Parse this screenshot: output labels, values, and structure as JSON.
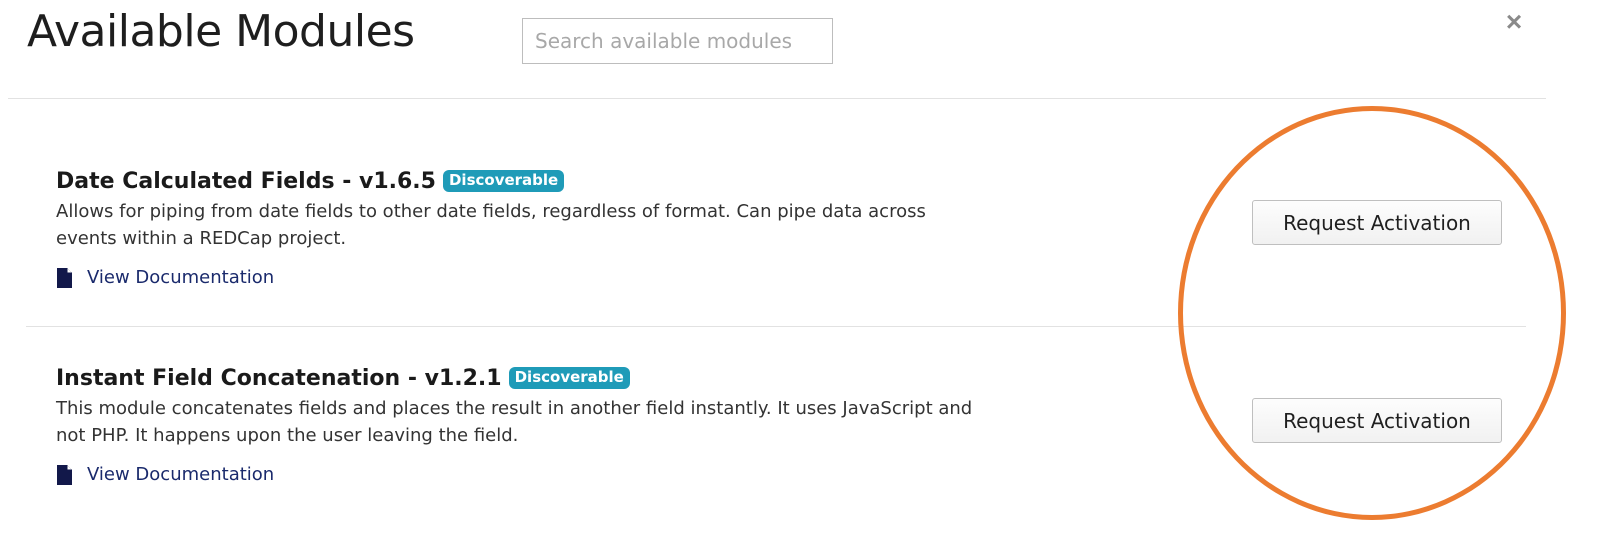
{
  "header": {
    "title": "Available Modules",
    "search_placeholder": "Search available modules",
    "search_value": "",
    "close_label": "×"
  },
  "modules": [
    {
      "name": "Date Calculated Fields - v1.6.5",
      "badge": "Discoverable",
      "description": "Allows for piping from date fields to other date fields, regardless of format. Can pipe data across events within a REDCap project.",
      "doc_link": "View Documentation",
      "action_label": "Request Activation"
    },
    {
      "name": "Instant Field Concatenation - v1.2.1",
      "badge": "Discoverable",
      "description": "This module concatenates fields and places the result in another field instantly. It uses JavaScript and not PHP. It happens upon the user leaving the field.",
      "doc_link": "View Documentation",
      "action_label": "Request Activation"
    }
  ],
  "icons": {
    "document": "document-icon",
    "close": "close-icon"
  },
  "colors": {
    "badge": "#1f9bb8",
    "highlight": "#ec7c30",
    "link": "#1a2a6c"
  }
}
